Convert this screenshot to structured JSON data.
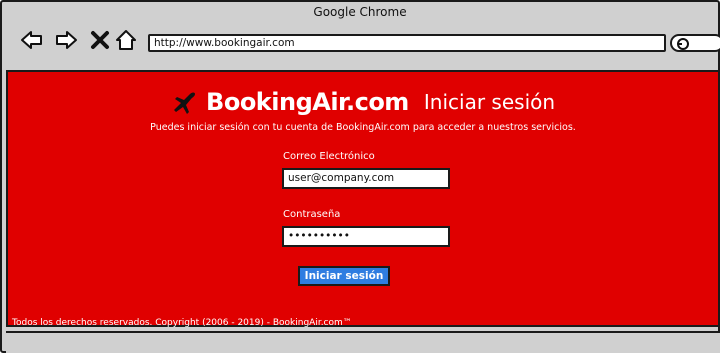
{
  "browser": {
    "title": "Google Chrome",
    "url": "http://www.bookingair.com"
  },
  "page": {
    "brand_name": "BookingAir.com",
    "login_heading": "Iniciar sesión",
    "subtitle": "Puedes iniciar sesión con tu cuenta de BookingAir.com para acceder a nuestros servicios.",
    "email_label": "Correo Electrónico",
    "email_value": "user@company.com",
    "password_label": "Contraseña",
    "password_value": "••••••••••",
    "login_button": "Iniciar sesión",
    "footer": "Todos los derechos reservados. Copyright (2006 - 2019) - BookingAir.com™"
  },
  "colors": {
    "page_background": "#e00000",
    "button_background": "#2f7de1",
    "chrome_background": "#d0d0d0"
  }
}
